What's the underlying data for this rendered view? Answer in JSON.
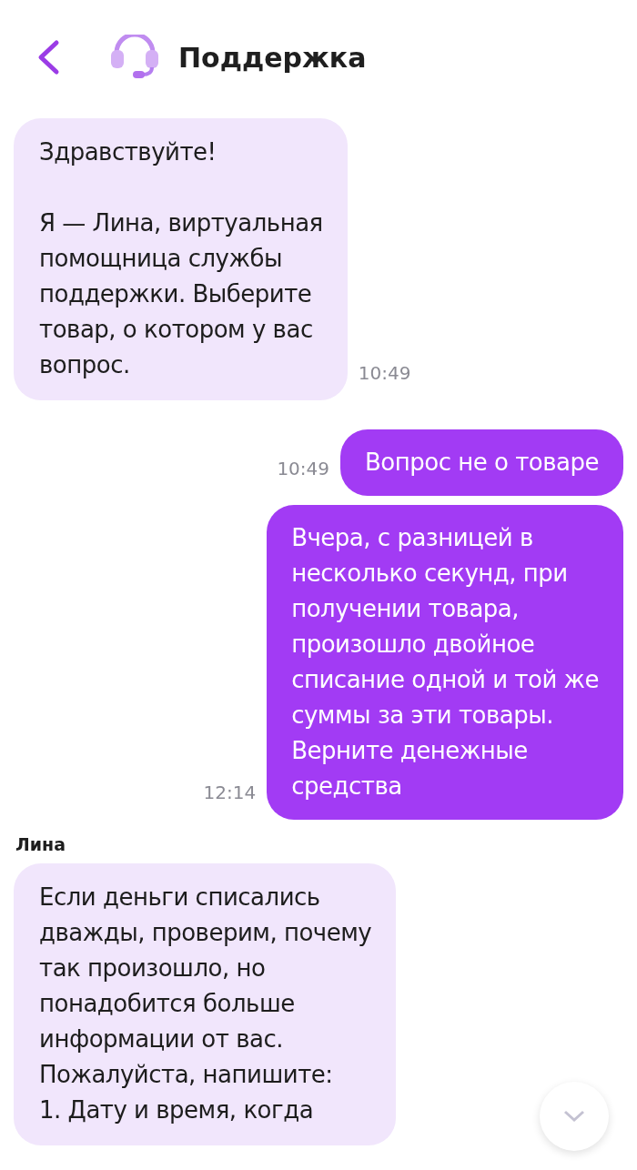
{
  "header": {
    "title": "Поддержка"
  },
  "messages": [
    {
      "kind": "incoming",
      "text": "Здравствуйте!\n\nЯ — Лина, виртуальная\nпомощница службы\nподдержки. Выберите\nтовар, о котором у вас\nвопрос.",
      "time": "10:49"
    },
    {
      "kind": "outgoing",
      "text": "Вопрос не о товаре",
      "time": "10:49"
    },
    {
      "kind": "outgoing",
      "text": "Вчера, с разницей в\nнесколько секунд, при\nполучении товара,\nпроизошло двойное\nсписание одной и той же\nсуммы за эти товары.\nВерните денежные\nсредства",
      "time": "12:14"
    },
    {
      "kind": "incoming",
      "sender": "Лина",
      "text": "Если деньги списались\nдважды, проверим, почему\nтак произошло, но\nпонадобится больше\nинформации от вас.\nПожалуйста, напишите:\n1. Дату и время, когда"
    }
  ]
}
